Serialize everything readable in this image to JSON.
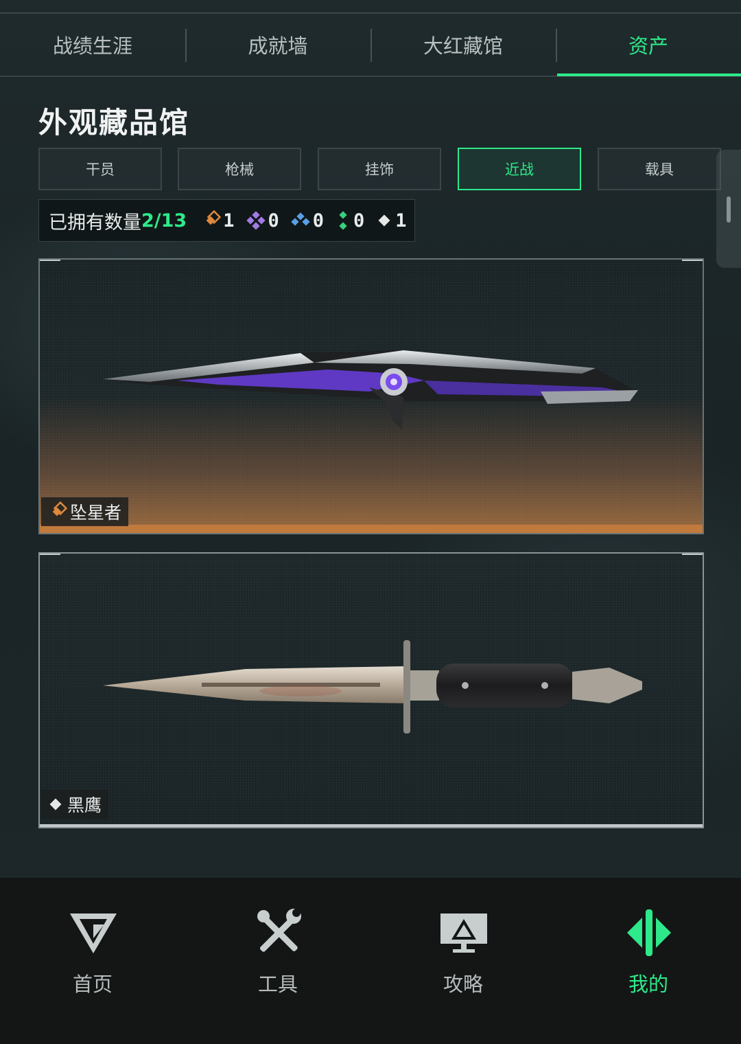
{
  "top_tabs": [
    {
      "label": "战绩生涯"
    },
    {
      "label": "成就墙"
    },
    {
      "label": "大红藏馆"
    },
    {
      "label": "资产"
    }
  ],
  "page_title": "外观藏品馆",
  "categories": [
    {
      "label": "干员"
    },
    {
      "label": "枪械"
    },
    {
      "label": "挂饰"
    },
    {
      "label": "近战"
    },
    {
      "label": "载具"
    }
  ],
  "selected_category": "近战",
  "owned": {
    "label": "已拥有数量",
    "count": "2/13",
    "rarities": [
      {
        "icon": "orange-rarity-icon",
        "color": "#e0893c",
        "value": "1"
      },
      {
        "icon": "purple-rarity-icon",
        "color": "#a27ae6",
        "value": "0"
      },
      {
        "icon": "blue-rarity-icon",
        "color": "#5a9ee6",
        "value": "0"
      },
      {
        "icon": "green-rarity-icon",
        "color": "#36d07e",
        "value": "0"
      },
      {
        "icon": "white-rarity-icon",
        "color": "#e6e8e8",
        "value": "1"
      }
    ]
  },
  "items": [
    {
      "name": "坠星者",
      "rarity_color": "#e0893c"
    },
    {
      "name": "黑鹰",
      "rarity_color": "#e6e8e8"
    }
  ],
  "bottom_nav": [
    {
      "label": "首页",
      "icon": "home-icon"
    },
    {
      "label": "工具",
      "icon": "tools-icon"
    },
    {
      "label": "攻略",
      "icon": "guide-icon"
    },
    {
      "label": "我的",
      "icon": "profile-icon"
    }
  ],
  "accent_color": "#2ee98a"
}
